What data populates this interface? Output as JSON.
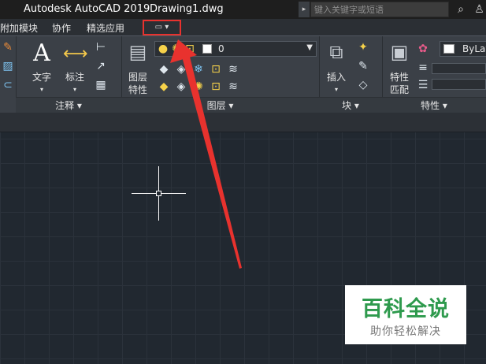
{
  "titlebar": {
    "app_title": "Autodesk AutoCAD 2019",
    "file_name": "Drawing1.dwg",
    "search_placeholder": "键入关键字或短语",
    "search_arrow": "▸",
    "binoculars_icon": "⌕",
    "user_icon": "♙"
  },
  "tabs": {
    "addin": "附加模块",
    "collaborate": "协作",
    "featured": "精选应用",
    "toggle_glyph": "▭ ▾"
  },
  "ribbon": {
    "annotation": {
      "text_label": "文字",
      "dim_label": "标注",
      "panel_label": "注释 ▾",
      "text_icon": "A"
    },
    "layers": {
      "layer_props_label_1": "图层",
      "layer_props_label_2": "特性",
      "current_layer": "0",
      "panel_label": "图层 ▾"
    },
    "block": {
      "insert_label": "插入",
      "panel_label": "块 ▾"
    },
    "properties": {
      "match_label_1": "特性",
      "match_label_2": "匹配",
      "color_value": "ByLayer",
      "panel_label": "特性 ▾"
    }
  },
  "watermark": {
    "main": "百科全说",
    "sub": "助你轻松解决"
  },
  "colors": {
    "highlight": "#e8322e",
    "canvas": "#212830",
    "watermark_green": "#2e9a4d"
  }
}
